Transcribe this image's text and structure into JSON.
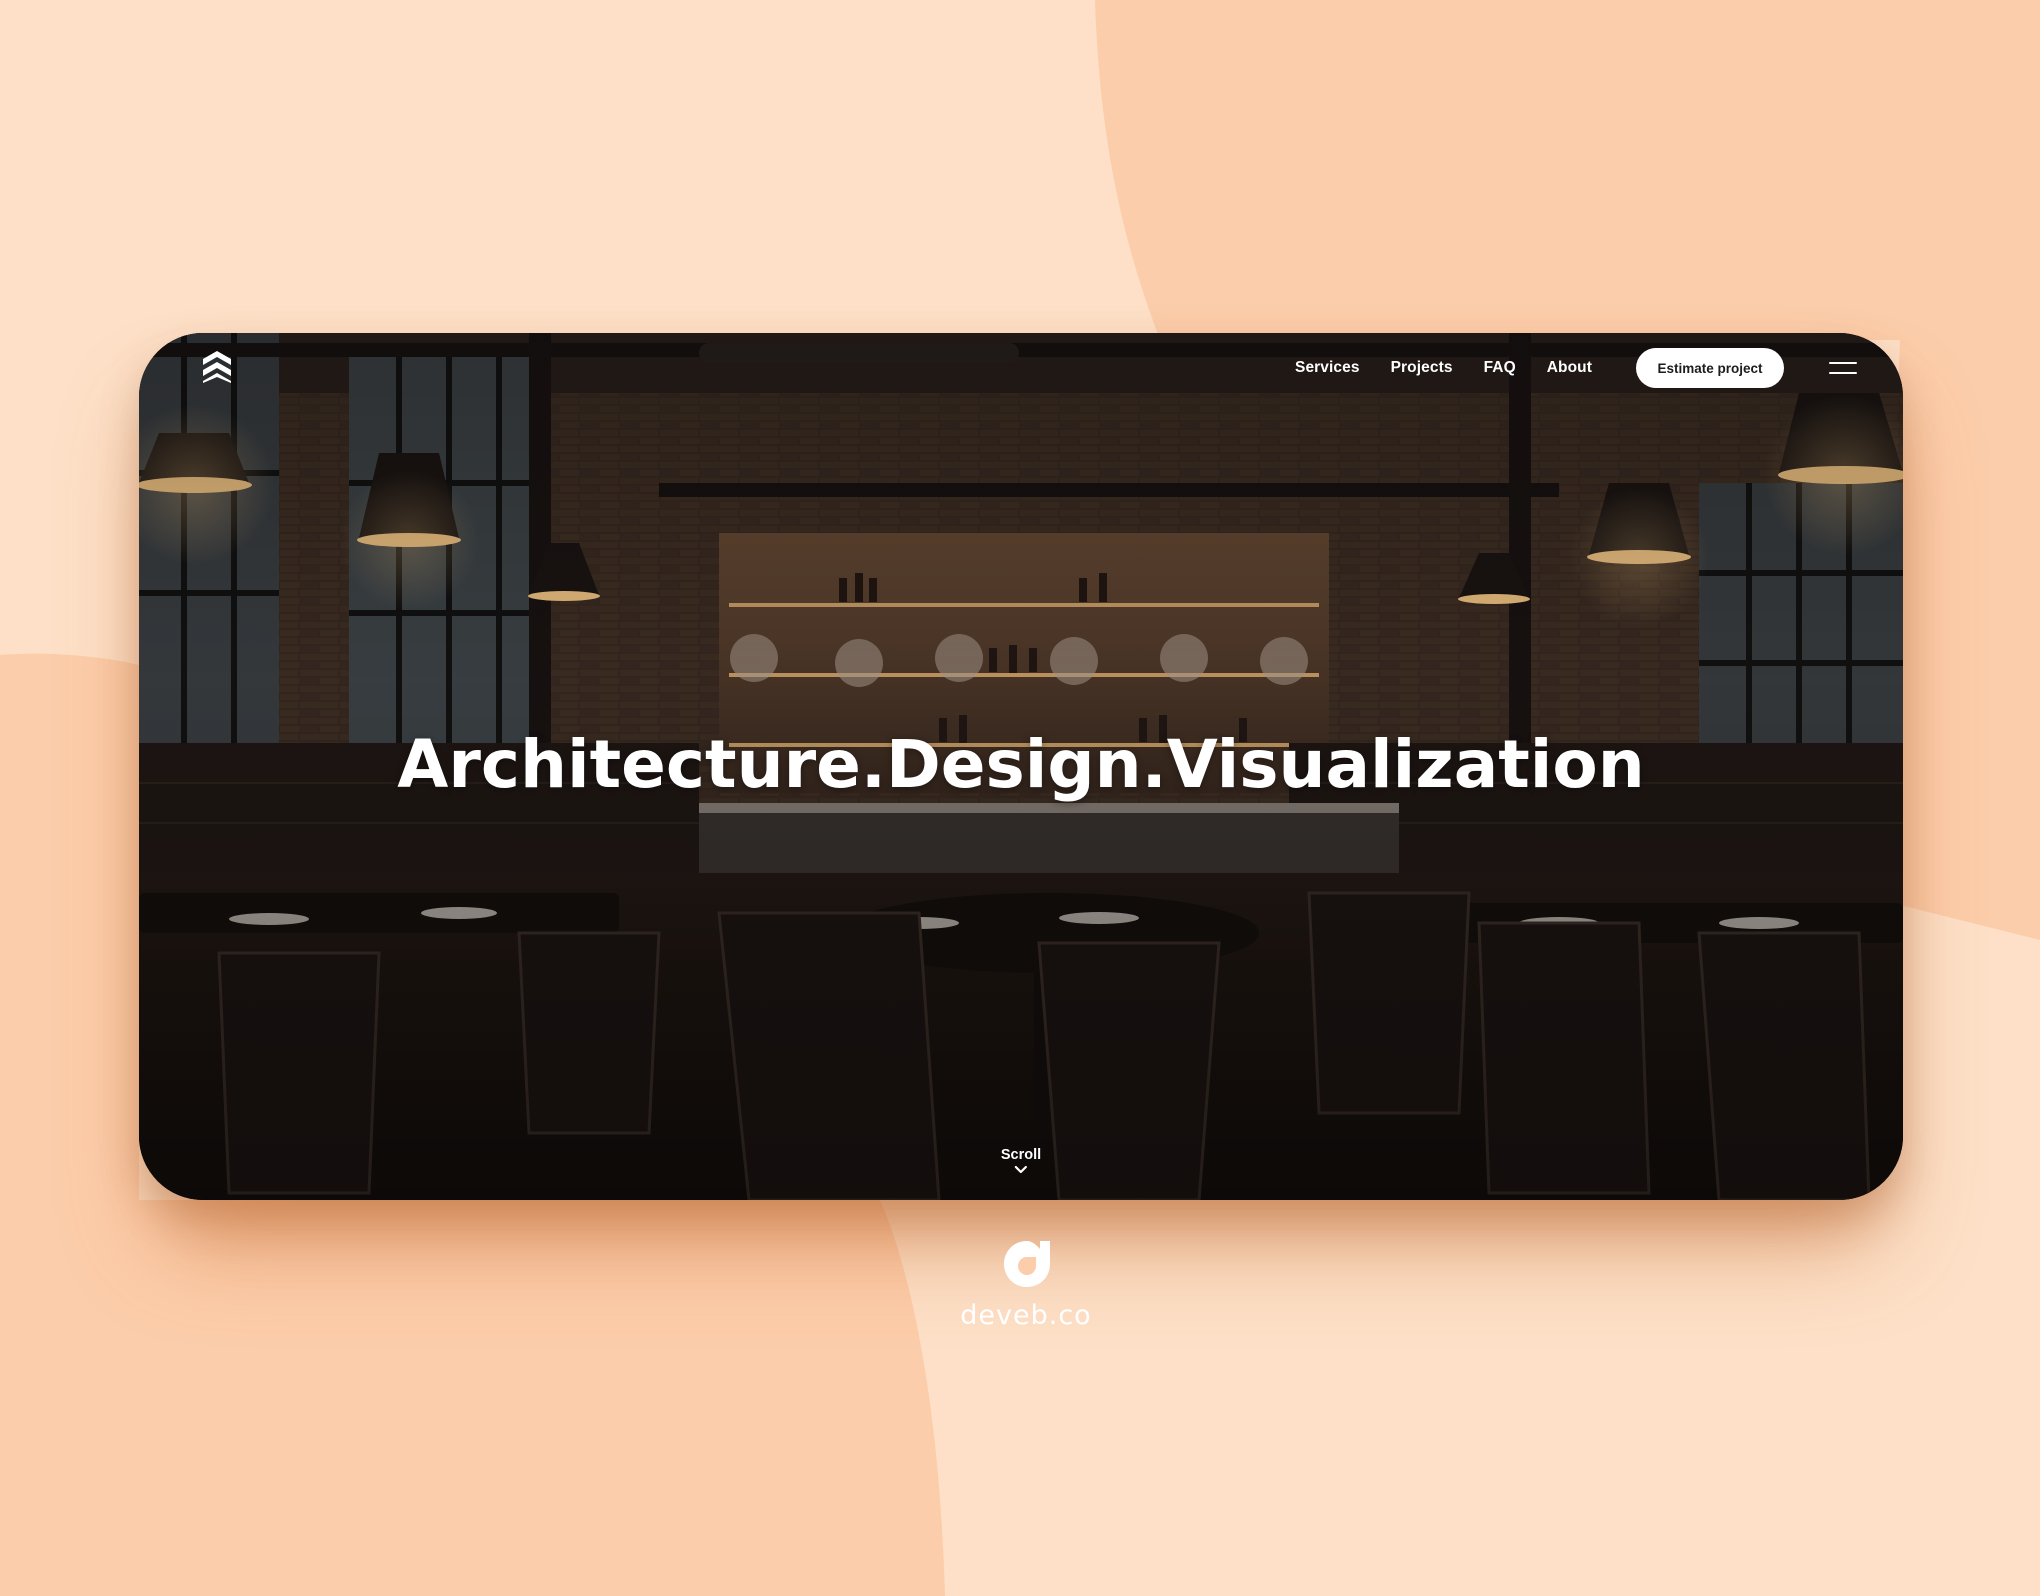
{
  "colors": {
    "background_light": "#fde0c7",
    "background_dark": "#fcccaa",
    "text_white": "#ffffff",
    "button_bg": "#ffffff",
    "button_text": "#1d1d1d"
  },
  "header": {
    "logo_icon": "stacked-chevrons-icon",
    "nav": {
      "services": "Services",
      "projects": "Projects",
      "faq": "FAQ",
      "about": "About"
    },
    "cta_label": "Estimate project",
    "menu_icon": "hamburger-menu-icon"
  },
  "hero": {
    "headline": "Architecture.Design.Visualization",
    "scroll_label": "Scroll",
    "scroll_icon": "chevron-down-icon",
    "background": "restaurant-interior-photo"
  },
  "brand": {
    "logo_icon": "deveb-logo-icon",
    "name": "deveb.co"
  }
}
